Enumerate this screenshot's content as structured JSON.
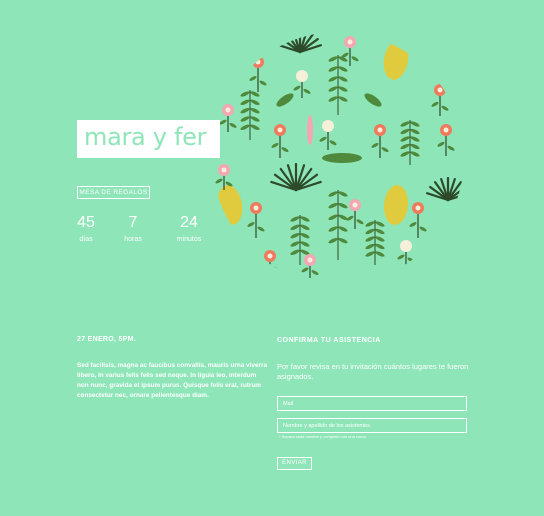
{
  "colors": {
    "background": "#8ee6b8",
    "text": "#ffffff",
    "leaf_dark": "#2d4a2a",
    "leaf_green": "#4f8a3c",
    "leaf_yellow": "#e0cb3f",
    "flower_coral": "#f07a5e",
    "flower_pink": "#f4a6b5",
    "flower_cream": "#f6efd9"
  },
  "title": "mara y fer",
  "registry_button": "MESA DE REGALOS",
  "countdown": {
    "days": {
      "value": "45",
      "label": "días"
    },
    "hours": {
      "value": "7",
      "label": "horas"
    },
    "minutes": {
      "value": "24",
      "label": "minutos"
    }
  },
  "event": {
    "date_heading": "27 ENERO, 5PM.",
    "description": "Sed facilisis, magna ac faucibus convallis, mauris urna viverra libero, in varius felis felis sed neque. In ligula leo, interdum non nunc, gravida et ipsum purus. Quisque felis erat, rutrum consectetur nec, ornare pellentesque diam."
  },
  "rsvp": {
    "heading": "CONFIRMA TU ASISTENCIA",
    "instructions": "Por favor revisa en tu invitación cuántos lugares te fueron asignados.",
    "mail_placeholder": "Mail",
    "names_placeholder": "Nombre y apellido de los asistentes",
    "names_hint": "* Separa cada nombre y completo con una coma",
    "submit_label": "ENVIAR"
  },
  "illustration": {
    "name": "floral-circle-illustration"
  }
}
